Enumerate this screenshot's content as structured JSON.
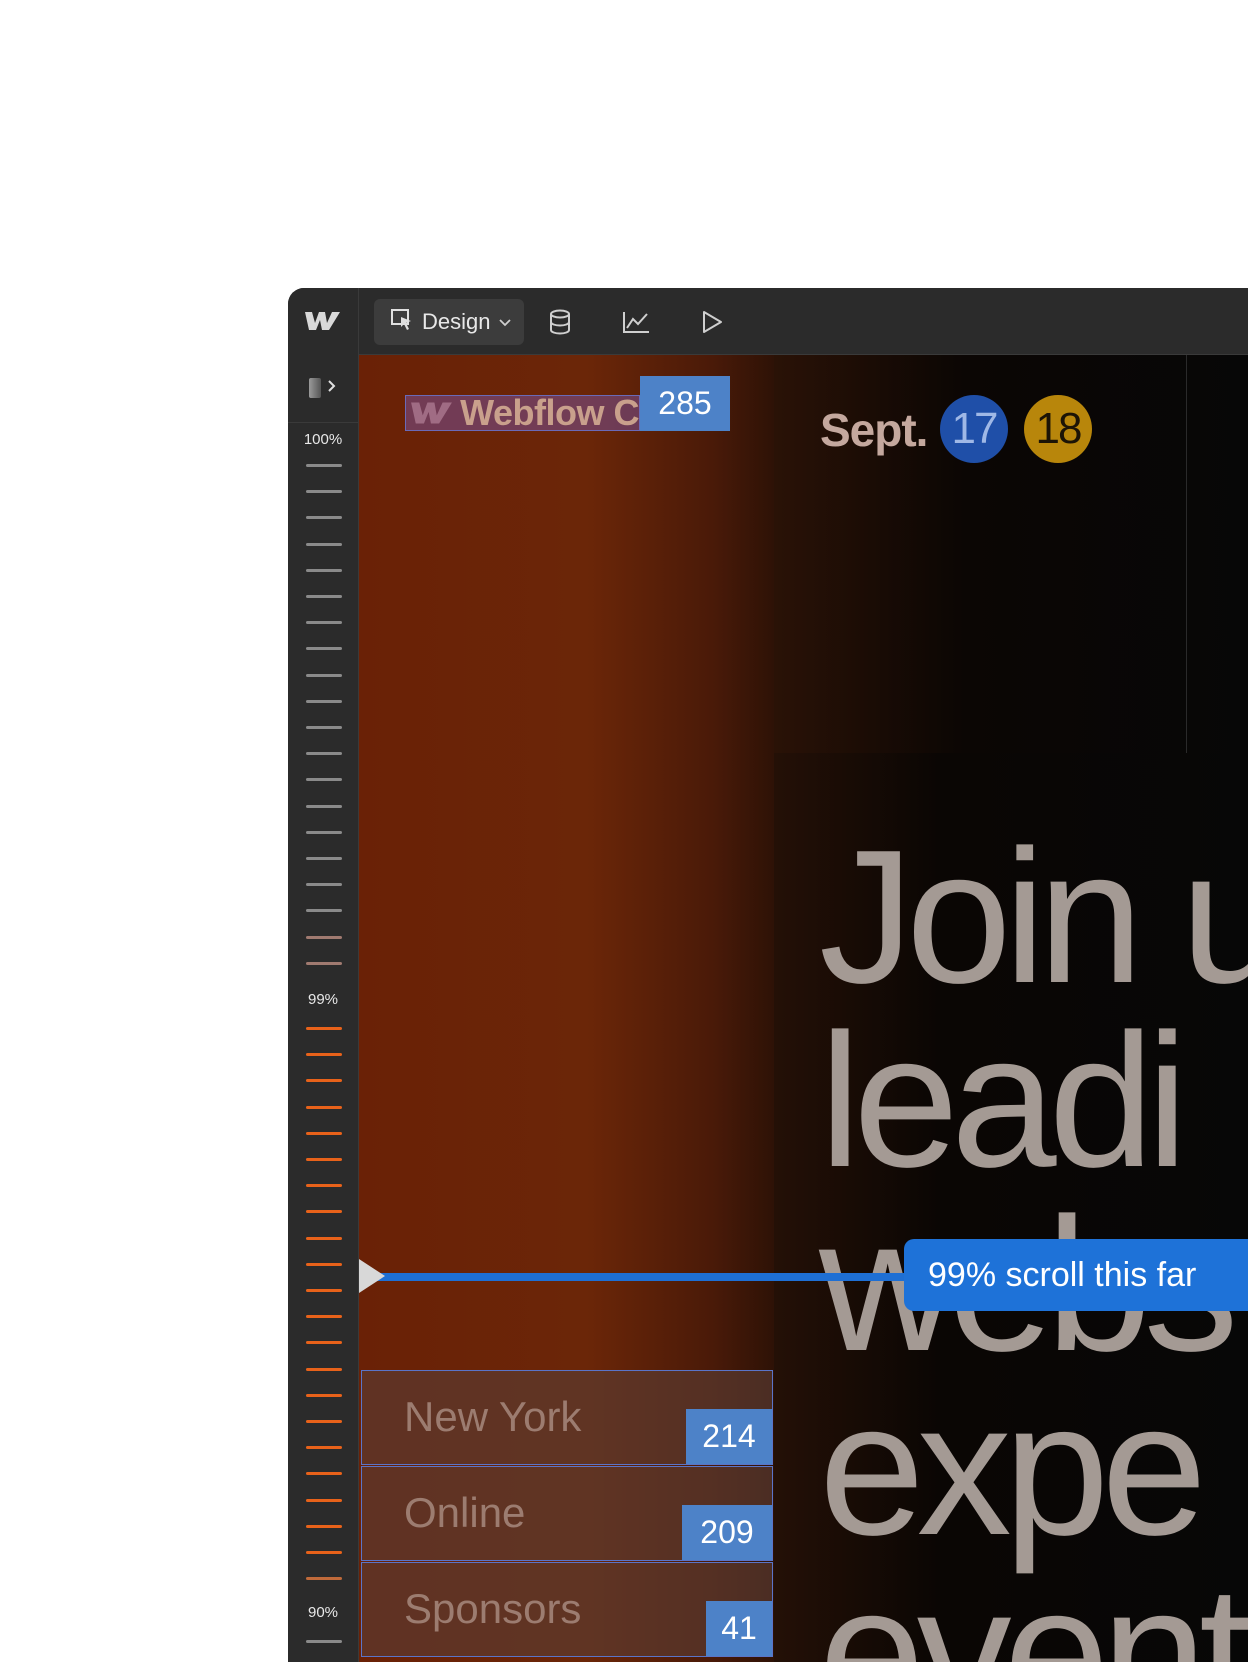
{
  "toolbar": {
    "logo": "webflow-logo",
    "mode_label": "Design",
    "tools": [
      "database-icon",
      "analytics-icon",
      "play-icon"
    ]
  },
  "ruler": {
    "label_top": "100%",
    "label_mid": "99%",
    "label_bottom": "90%"
  },
  "canvas": {
    "brand_text": "Webflow C",
    "brand_count": "285",
    "month": "Sept.",
    "day_1": "17",
    "day_2": "18",
    "headline": [
      "Join u",
      "leadi",
      "webs",
      "expe",
      "event"
    ],
    "list": [
      {
        "label": "New York",
        "count": "214"
      },
      {
        "label": "Online",
        "count": "209"
      },
      {
        "label": "Sponsors",
        "count": "41"
      }
    ],
    "scroll_tooltip": "99% scroll this far",
    "scroll_depth": 0.99
  },
  "colors": {
    "accent_blue": "#1e72d8",
    "badge_blue": "#4d82c8",
    "day_1_bg": "#1f4fa8",
    "day_2_bg": "#b8860b",
    "tick_orange": "#e8621a",
    "tick_gray": "#8a8a8a"
  }
}
